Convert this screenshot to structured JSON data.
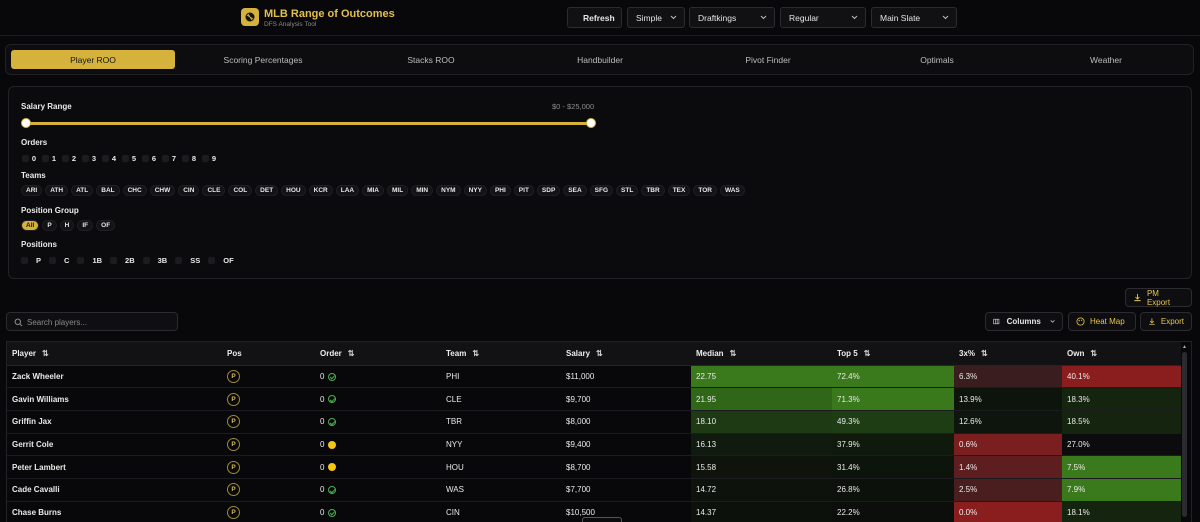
{
  "header": {
    "title": "MLB Range of Outcomes",
    "subtitle": "DFS Analysis Tool",
    "refresh_label": "Refresh",
    "mode": "Simple",
    "site": "Draftkings",
    "game_type": "Regular",
    "slate": "Main Slate"
  },
  "tabs": [
    "Player ROO",
    "Scoring Percentages",
    "Stacks ROO",
    "Handbuilder",
    "Pivot Finder",
    "Optimals",
    "Weather"
  ],
  "filters": {
    "salary_label": "Salary Range",
    "salary_value": "$0 - $25,000",
    "orders_label": "Orders",
    "orders": [
      "0",
      "1",
      "2",
      "3",
      "4",
      "5",
      "6",
      "7",
      "8",
      "9"
    ],
    "teams_label": "Teams",
    "teams": [
      "ARI",
      "ATH",
      "ATL",
      "BAL",
      "CHC",
      "CHW",
      "CIN",
      "CLE",
      "COL",
      "DET",
      "HOU",
      "KCR",
      "LAA",
      "MIA",
      "MIL",
      "MIN",
      "NYM",
      "NYY",
      "PHI",
      "PIT",
      "SDP",
      "SEA",
      "SFG",
      "STL",
      "TBR",
      "TEX",
      "TOR",
      "WAS"
    ],
    "position_group_label": "Position Group",
    "position_groups": [
      "All",
      "P",
      "H",
      "IF",
      "OF"
    ],
    "positions_label": "Positions",
    "positions": [
      "P",
      "C",
      "1B",
      "2B",
      "3B",
      "SS",
      "OF"
    ]
  },
  "toolbar": {
    "pm_export": "PM Export",
    "search_placeholder": "Search players...",
    "columns": "Columns",
    "heat_map": "Heat Map",
    "export": "Export"
  },
  "table": {
    "columns": [
      "Player",
      "Pos",
      "Order",
      "Team",
      "Salary",
      "Median",
      "Top 5",
      "3x%",
      "Own"
    ],
    "rows": [
      {
        "player": "Zack Wheeler",
        "pos": "P",
        "order": "0",
        "status": "confirmed",
        "team": "PHI",
        "salary": "$11,000",
        "median": "22.75",
        "top5": "72.4%",
        "x3": "6.3%",
        "own": "40.1%"
      },
      {
        "player": "Gavin Williams",
        "pos": "P",
        "order": "0",
        "status": "confirmed",
        "team": "CLE",
        "salary": "$9,700",
        "median": "21.95",
        "top5": "71.3%",
        "x3": "13.9%",
        "own": "18.3%"
      },
      {
        "player": "Griffin Jax",
        "pos": "P",
        "order": "0",
        "status": "confirmed",
        "team": "TBR",
        "salary": "$8,000",
        "median": "18.10",
        "top5": "49.3%",
        "x3": "12.6%",
        "own": "18.5%"
      },
      {
        "player": "Gerrit Cole",
        "pos": "P",
        "order": "0",
        "status": "pending",
        "team": "NYY",
        "salary": "$9,400",
        "median": "16.13",
        "top5": "37.9%",
        "x3": "0.6%",
        "own": "27.0%"
      },
      {
        "player": "Peter Lambert",
        "pos": "P",
        "order": "0",
        "status": "pending",
        "team": "HOU",
        "salary": "$8,700",
        "median": "15.58",
        "top5": "31.4%",
        "x3": "1.4%",
        "own": "7.5%"
      },
      {
        "player": "Cade Cavalli",
        "pos": "P",
        "order": "0",
        "status": "confirmed",
        "team": "WAS",
        "salary": "$7,700",
        "median": "14.72",
        "top5": "26.8%",
        "x3": "2.5%",
        "own": "7.9%"
      },
      {
        "player": "Chase Burns",
        "pos": "P",
        "order": "0",
        "status": "confirmed",
        "team": "CIN",
        "salary": "$10,500",
        "median": "14.37",
        "top5": "22.2%",
        "x3": "0.0%",
        "own": "18.1%"
      }
    ]
  },
  "heat_colors": {
    "median": [
      "#3b7a1c",
      "#2f6618",
      "#1d3a14",
      "#101a0e",
      "#0e140c",
      "#0d120c",
      "#0c110b"
    ],
    "top5": [
      "#3b7a1c",
      "#3a781c",
      "#1e3d15",
      "#0f1a0d",
      "#0d140c",
      "#0c110b",
      "#0b0e0b"
    ],
    "x3": [
      "#3a1d1e",
      "#0d140c",
      "#0e150d",
      "#7a1e1f",
      "#5e1d1e",
      "#4a1e1f",
      "#8a1e1e"
    ],
    "own": [
      "#8a1e1e",
      "#15240f",
      "#15240f",
      "#0c0c0e",
      "#3b7a1c",
      "#3b7a1c",
      "#15240f"
    ]
  }
}
